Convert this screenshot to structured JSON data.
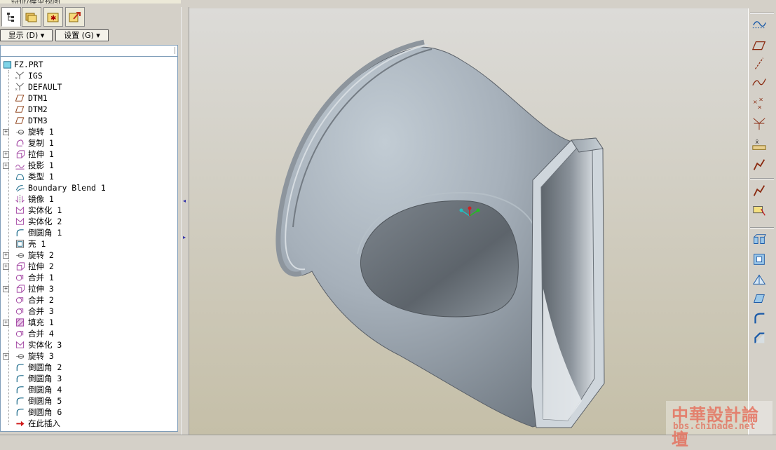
{
  "window": {
    "title_fragment": "特征/模型视图"
  },
  "navigator": {
    "tabs": [
      {
        "name": "model-tree-tab",
        "icon": "model-tree-icon"
      },
      {
        "name": "folder-browser-tab",
        "icon": "folder-icon"
      },
      {
        "name": "favorites-tab",
        "icon": "favorites-icon"
      },
      {
        "name": "connections-tab",
        "icon": "connections-icon"
      }
    ],
    "show_menu_label": "显示 (D) ▾",
    "settings_menu_label": "设置 (G) ▾"
  },
  "model_tree": {
    "root": "FZ.PRT",
    "items": [
      {
        "label": "IGS",
        "icon": "coordinate-system-icon",
        "expandable": false
      },
      {
        "label": "DEFAULT",
        "icon": "coordinate-system-icon",
        "expandable": false
      },
      {
        "label": "DTM1",
        "icon": "datum-plane-icon",
        "expandable": false
      },
      {
        "label": "DTM2",
        "icon": "datum-plane-icon",
        "expandable": false
      },
      {
        "label": "DTM3",
        "icon": "datum-plane-icon",
        "expandable": false
      },
      {
        "label": "旋转 1",
        "icon": "revolve-icon",
        "expandable": true
      },
      {
        "label": "复制 1",
        "icon": "copy-icon",
        "expandable": false
      },
      {
        "label": "拉伸 1",
        "icon": "extrude-icon",
        "expandable": true
      },
      {
        "label": "投影 1",
        "icon": "project-icon",
        "expandable": true
      },
      {
        "label": "类型 1",
        "icon": "surface-icon",
        "expandable": false
      },
      {
        "label": "Boundary Blend 1",
        "icon": "boundary-blend-icon",
        "expandable": false
      },
      {
        "label": "镜像 1",
        "icon": "mirror-icon",
        "expandable": false
      },
      {
        "label": "实体化 1",
        "icon": "solidify-icon",
        "expandable": false
      },
      {
        "label": "实体化 2",
        "icon": "solidify-icon",
        "expandable": false
      },
      {
        "label": "倒圆角 1",
        "icon": "round-icon",
        "expandable": false
      },
      {
        "label": "壳 1",
        "icon": "shell-icon",
        "expandable": false
      },
      {
        "label": "旋转 2",
        "icon": "revolve-icon",
        "expandable": true
      },
      {
        "label": "拉伸 2",
        "icon": "extrude-icon",
        "expandable": true
      },
      {
        "label": "合并 1",
        "icon": "merge-icon",
        "expandable": false
      },
      {
        "label": "拉伸 3",
        "icon": "extrude-icon",
        "expandable": true
      },
      {
        "label": "合并 2",
        "icon": "merge-icon",
        "expandable": false
      },
      {
        "label": "合并 3",
        "icon": "merge-icon",
        "expandable": false
      },
      {
        "label": "填充 1",
        "icon": "fill-icon",
        "expandable": true
      },
      {
        "label": "合并 4",
        "icon": "merge-icon",
        "expandable": false
      },
      {
        "label": "实体化 3",
        "icon": "solidify-icon",
        "expandable": false
      },
      {
        "label": "旋转 3",
        "icon": "revolve-icon",
        "expandable": true
      },
      {
        "label": "倒圆角 2",
        "icon": "round-icon",
        "expandable": false
      },
      {
        "label": "倒圆角 3",
        "icon": "round-icon",
        "expandable": false
      },
      {
        "label": "倒圆角 4",
        "icon": "round-icon",
        "expandable": false
      },
      {
        "label": "倒圆角 5",
        "icon": "round-icon",
        "expandable": false
      },
      {
        "label": "倒圆角 6",
        "icon": "round-icon",
        "expandable": false
      },
      {
        "label": "在此插入",
        "icon": "insert-here-icon",
        "expandable": false
      }
    ]
  },
  "right_toolbar": {
    "tools": [
      "datum-display-icon",
      "datum-plane-tool-icon",
      "datum-axis-tool-icon",
      "datum-curve-tool-icon",
      "datum-point-tool-icon",
      "coordinate-system-tool-icon",
      "analysis-tool-icon",
      "sketch-tool-icon",
      "sketch-tool-icon",
      "placement-tool-icon",
      "extrude-tool-icon",
      "shell-tool-icon",
      "rib-tool-icon",
      "draft-tool-icon",
      "round-tool-icon",
      "chamfer-tool-icon"
    ]
  },
  "watermark": {
    "chinese": "中華設計論壇",
    "url": "bbs.chinade.net"
  },
  "colors": {
    "tree_border": "#7f9db9",
    "model_face": "#a3adb8",
    "accent_blue": "#0a6fb3"
  }
}
